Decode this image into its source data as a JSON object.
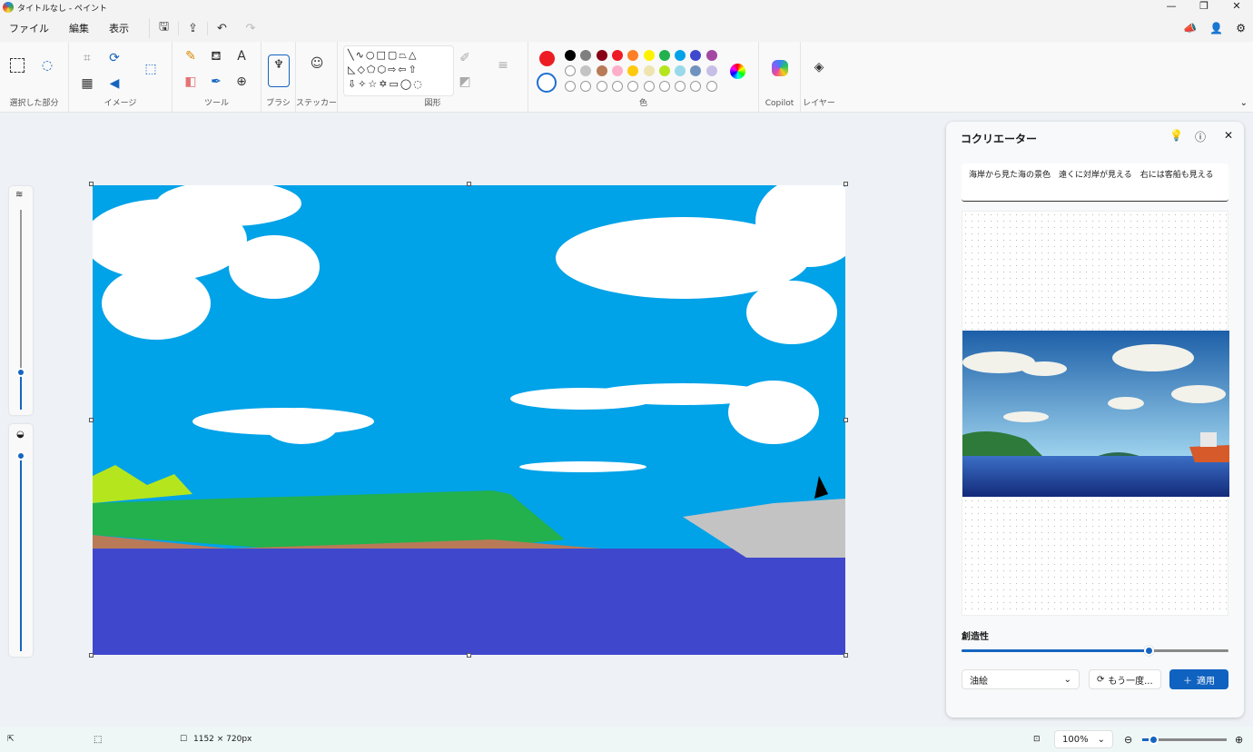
{
  "window": {
    "title": "タイトルなし - ペイント",
    "minimize": "—",
    "restore": "❐",
    "close": "✕"
  },
  "menu": {
    "file": "ファイル",
    "edit": "編集",
    "view": "表示"
  },
  "ribbon": {
    "selection": "選択した部分",
    "image": "イメージ",
    "tools": "ツール",
    "brush": "ブラシ",
    "sticker": "ステッカー",
    "shapes": "図形",
    "colors": "色",
    "copilot": "Copilot",
    "layers": "レイヤー"
  },
  "colors": {
    "primary": "#ed1c24",
    "secondary": "#ffffff",
    "row1": [
      "#000000",
      "#7f7f7f",
      "#880015",
      "#ed1c24",
      "#ff7f27",
      "#fff200",
      "#22b14c",
      "#00a2e8",
      "#3f48cc",
      "#a349a4"
    ],
    "row2": [
      "#ffffff",
      "#c3c3c3",
      "#b97a57",
      "#ffaec9",
      "#ffc90e",
      "#efe4b0",
      "#b5e61d",
      "#99d9ea",
      "#7092be",
      "#c8bfe7"
    ]
  },
  "cocreator": {
    "title": "コクリエーター",
    "prompt": "海岸から見た海の景色　遠くに対岸が見える　右には客船も見える",
    "creativity_label": "創造性",
    "creativity": 0.7,
    "style": "油絵",
    "retry": "もう一度...",
    "apply": "適用"
  },
  "status": {
    "size": "1152 × 720px",
    "zoom": "100%",
    "zoom_slider": 0.1
  }
}
